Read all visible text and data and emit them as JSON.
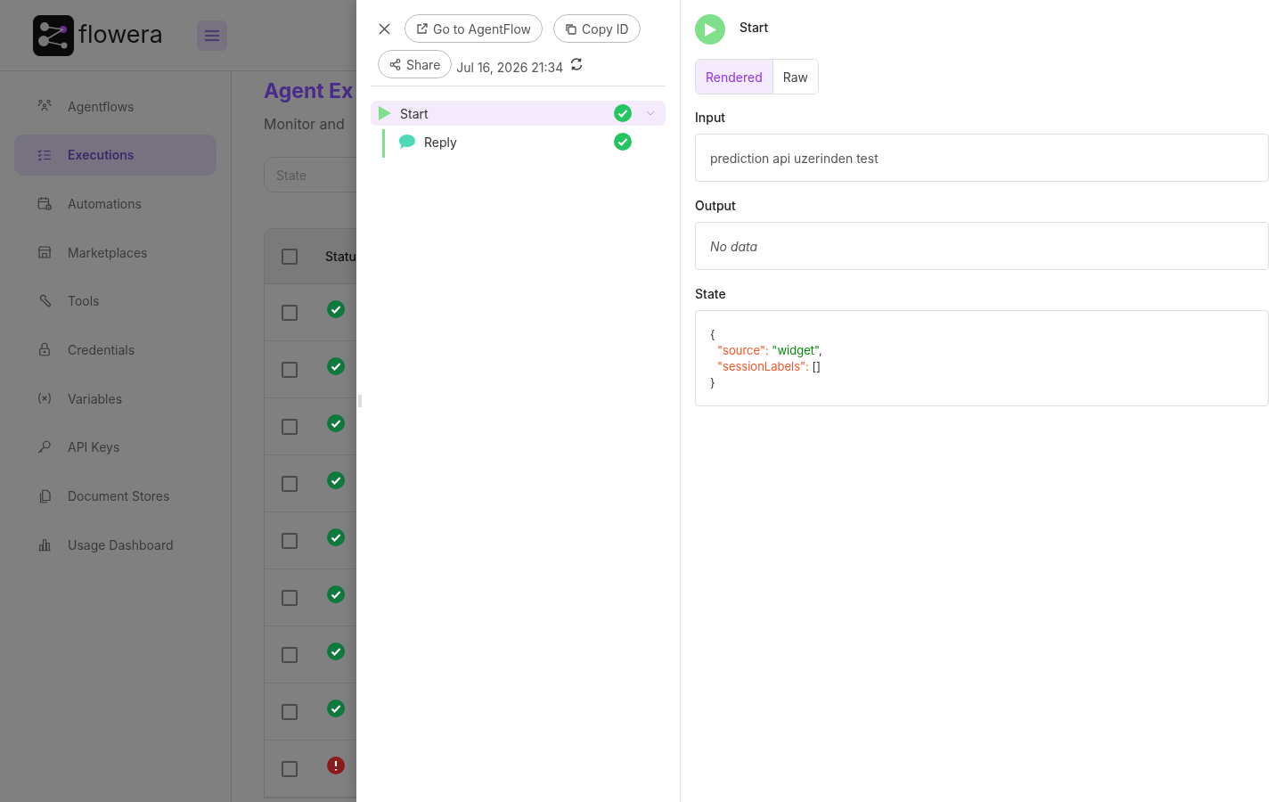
{
  "app": {
    "logo_text": "flowera"
  },
  "sidebar": {
    "items": [
      {
        "label": "Agentflows",
        "selected": false
      },
      {
        "label": "Executions",
        "selected": true
      },
      {
        "label": "Automations",
        "selected": false
      },
      {
        "label": "Marketplaces",
        "selected": false
      },
      {
        "label": "Tools",
        "selected": false
      },
      {
        "label": "Credentials",
        "selected": false
      },
      {
        "label": "Variables",
        "selected": false
      },
      {
        "label": "API Keys",
        "selected": false
      },
      {
        "label": "Document Stores",
        "selected": false
      },
      {
        "label": "Usage Dashboard",
        "selected": false
      }
    ]
  },
  "page": {
    "title": "Agent Ex",
    "subtitle": "Monitor and",
    "filter": {
      "placeholder": "State"
    },
    "table": {
      "columns": [
        "Statu"
      ],
      "header_checked": false,
      "rows": [
        {
          "checked": false,
          "failed": false
        },
        {
          "checked": false,
          "failed": false
        },
        {
          "checked": false,
          "failed": false
        },
        {
          "checked": false,
          "failed": false
        },
        {
          "checked": false,
          "failed": false
        },
        {
          "checked": false,
          "failed": false
        },
        {
          "checked": false,
          "failed": false
        },
        {
          "checked": false,
          "failed": false
        },
        {
          "checked": false,
          "failed": true
        }
      ]
    }
  },
  "drawer": {
    "toolbar": {
      "go_button": "Go to AgentFlow",
      "copy_button": "Copy ID",
      "share_button": "Share",
      "timestamp": "Jul 16, 2026 21:34"
    },
    "tree": [
      {
        "label": "Start",
        "kind": "start",
        "failed": false,
        "selected": true,
        "expanded": true,
        "children": [
          {
            "label": "Reply",
            "kind": "reply",
            "failed": false,
            "selected": false
          }
        ]
      }
    ],
    "detail": {
      "title": "Start",
      "tabs": [
        {
          "label": "Rendered",
          "selected": true
        },
        {
          "label": "Raw",
          "selected": false
        }
      ],
      "sections": [
        {
          "label": "Input",
          "kind": "text",
          "value": "prediction api uzerinden test"
        },
        {
          "label": "Output",
          "kind": "empty",
          "value": "No data"
        },
        {
          "label": "State",
          "kind": "json",
          "open": "{",
          "close": "}",
          "entries": [
            {
              "key": "\"source\":",
              "value": "\"widget\"",
              "kind": "string",
              "suffix": ","
            },
            {
              "key": "\"sessionLabels\":",
              "value": "[]",
              "kind": "array"
            }
          ]
        }
      ]
    }
  }
}
